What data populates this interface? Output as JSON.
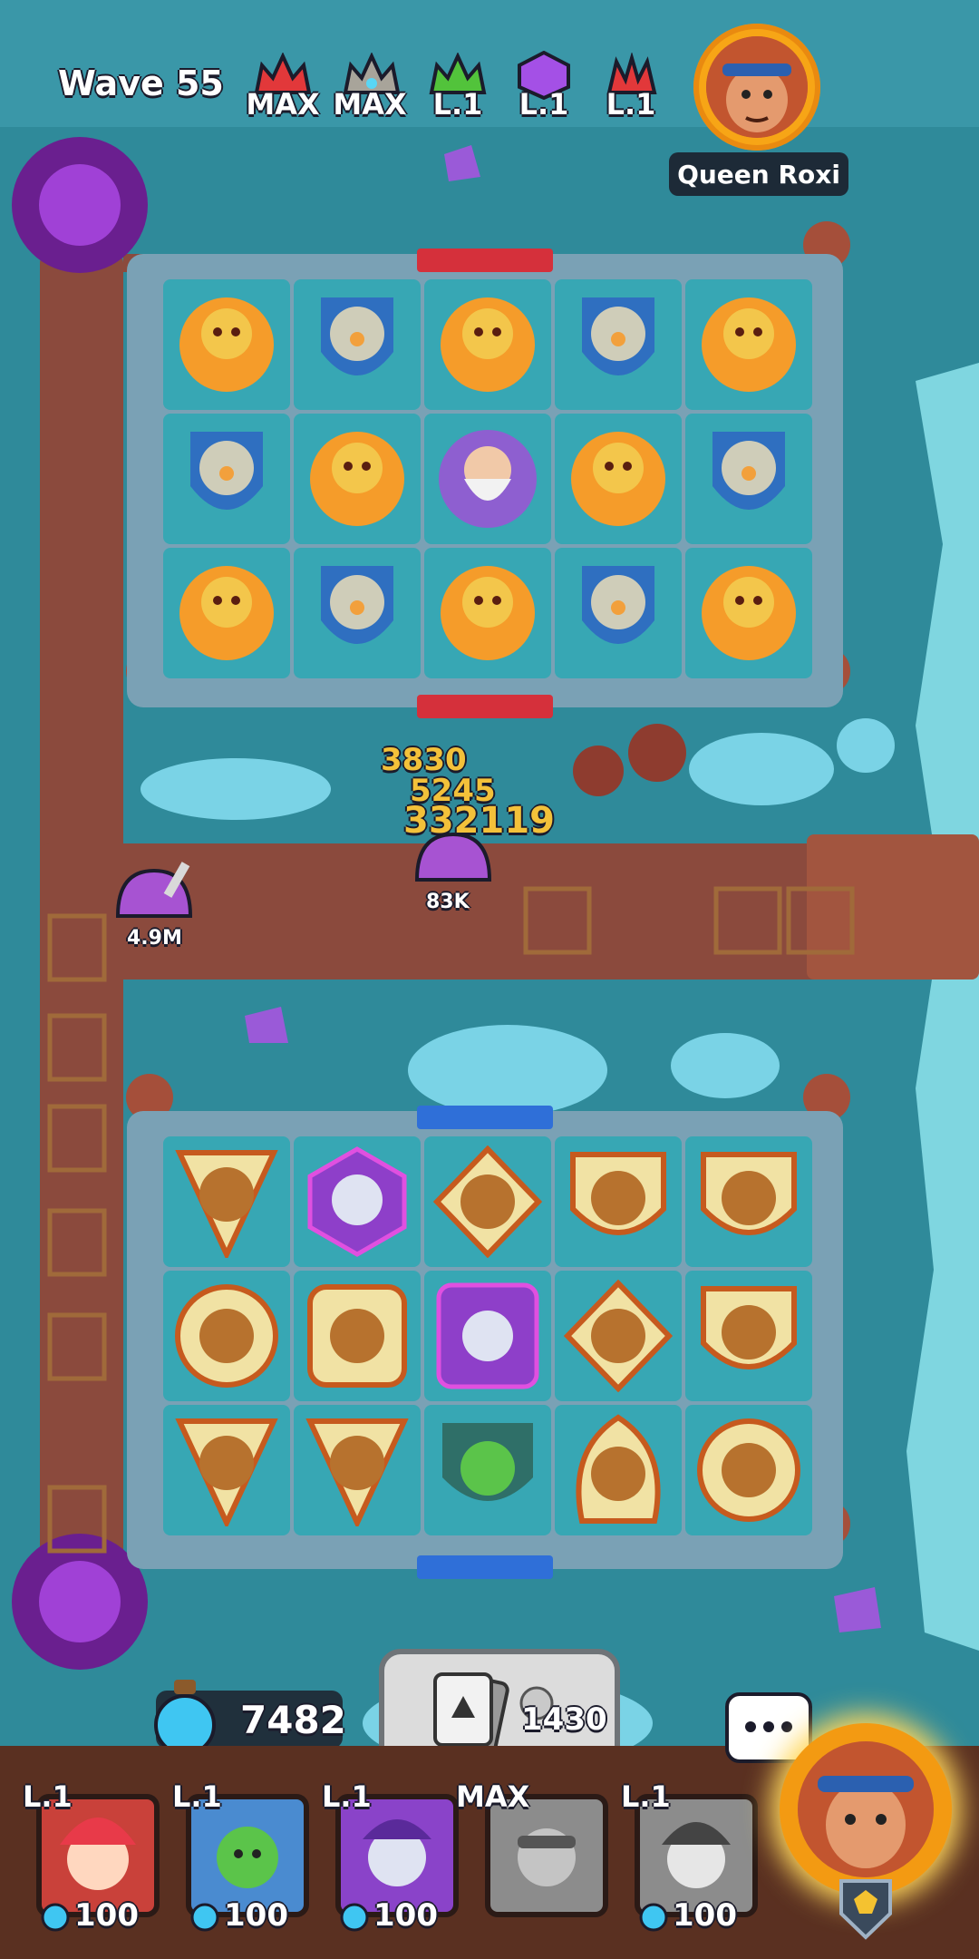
{
  "hud": {
    "wave_label": "Wave 55",
    "runes": [
      {
        "icon": "red-flame-rune-icon",
        "level": "MAX",
        "color": "#e2383a"
      },
      {
        "icon": "grey-crown-rune-icon",
        "level": "MAX",
        "color": "#a8a49a"
      },
      {
        "icon": "green-leaf-rune-icon",
        "level": "L.1",
        "color": "#52c33b"
      },
      {
        "icon": "purple-gem-rune-icon",
        "level": "L.1",
        "color": "#a450e6"
      },
      {
        "icon": "red-claw-rune-icon",
        "level": "L.1",
        "color": "#e2383a"
      }
    ],
    "opponent_name": "Queen Roxi"
  },
  "path": {
    "enemy_hp_a": "4.9M",
    "enemy_hp_b": "83K",
    "damage_numbers": [
      "3830",
      "5245",
      "332119"
    ]
  },
  "resources": {
    "mana": "7482",
    "summon_cost": "1430"
  },
  "deck": [
    {
      "level": "L.1",
      "cost": "100",
      "name": "jester-unit-icon",
      "bg": "#c9413a"
    },
    {
      "level": "L.1",
      "cost": "100",
      "name": "dryad-unit-icon",
      "bg": "#4a8bd0"
    },
    {
      "level": "L.1",
      "cost": "100",
      "name": "witch-unit-icon",
      "bg": "#8a43c9"
    },
    {
      "level": "MAX",
      "cost": "",
      "name": "rogue-unit-icon",
      "bg": "#8c8c8c"
    },
    {
      "level": "L.1",
      "cost": "100",
      "name": "knight-jester-unit-icon",
      "bg": "#8c8c8c"
    }
  ],
  "colors": {
    "board_tile": "#37a7b4",
    "fire_unit": "#f59c2a",
    "bear_unit": "#b7722e",
    "mage_unit": "#8e5fd0",
    "wall": "#8b4a3d"
  }
}
